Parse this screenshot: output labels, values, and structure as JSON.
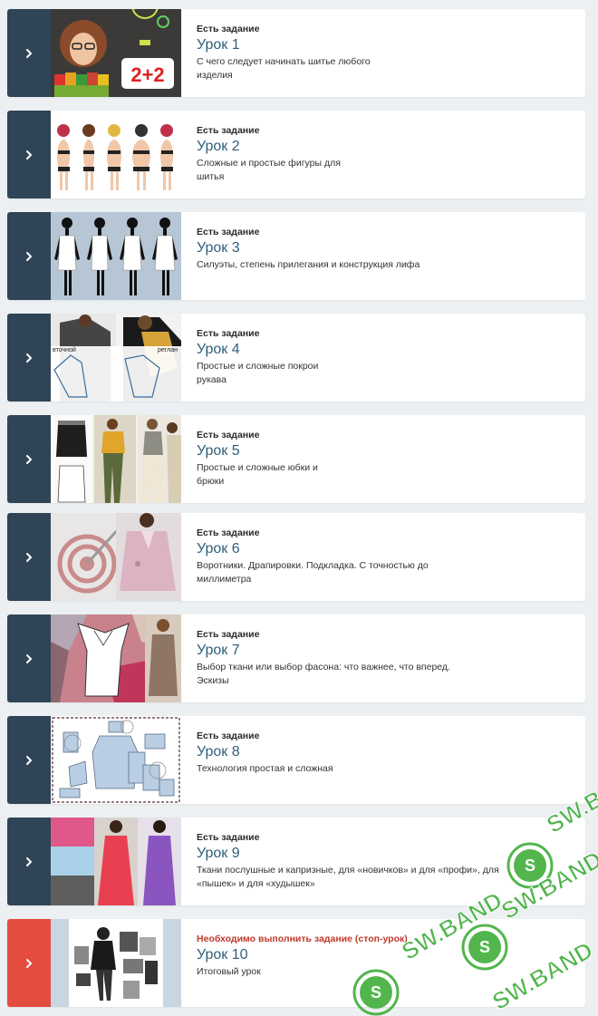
{
  "lessons": [
    {
      "status": "Есть задание",
      "title": "Урок 1",
      "desc": "С чего следует начинать шитье любого изделия",
      "thumb": "girl-with-lightbulb-2plus2"
    },
    {
      "status": "Есть задание",
      "title": "Урок 2",
      "desc": "Сложные и простые фигуры для шитья",
      "thumb": "figure-types"
    },
    {
      "status": "Есть задание",
      "title": "Урок 3",
      "desc": "Силуэты, степень прилегания и конструкция лифа",
      "thumb": "dress-silhouettes"
    },
    {
      "status": "Есть задание",
      "title": "Урок 4",
      "desc": "Простые и сложные покрои рукава",
      "thumb": "sleeve-cuts"
    },
    {
      "status": "Есть задание",
      "title": "Урок 5",
      "desc": "Простые и сложные юбки и брюки",
      "thumb": "skirts-and-trousers"
    },
    {
      "status": "Есть задание",
      "title": "Урок 6",
      "desc": "Воротники. Драпировки. Подкладка. С точностью до миллиметра",
      "thumb": "target-and-coat"
    },
    {
      "status": "Есть задание",
      "title": "Урок 7",
      "desc": "Выбор ткани или выбор фасона: что важнее, что вперед. Эскизы",
      "thumb": "fabric-and-dress-sketch"
    },
    {
      "status": "Есть задание",
      "title": "Урок 8",
      "desc": "Технология простая и сложная",
      "thumb": "garment-pattern-pieces"
    },
    {
      "status": "Есть задание",
      "title": "Урок 9",
      "desc": "Ткани послушные и капризные, для «новичков» и для «профи», для «пышек» и для «худышек»",
      "thumb": "fabrics-and-dresses"
    },
    {
      "status": "Необходимо выполнить задание (стоп-урок)",
      "title": "Урок 10",
      "desc": "Итоговый урок",
      "thumb": "final-collage",
      "stop": true
    }
  ],
  "watermark": {
    "text": "SW.BAND"
  },
  "thumb_labels": {
    "lesson1_math": "2+2",
    "lesson4_left": "вточной",
    "lesson4_right": "реглан"
  },
  "colors": {
    "strip": "#2f4457",
    "strip_stop": "#e44c3f",
    "title": "#2f5f7a",
    "stop_status": "#c0392b",
    "watermark": "#3fae3a"
  }
}
